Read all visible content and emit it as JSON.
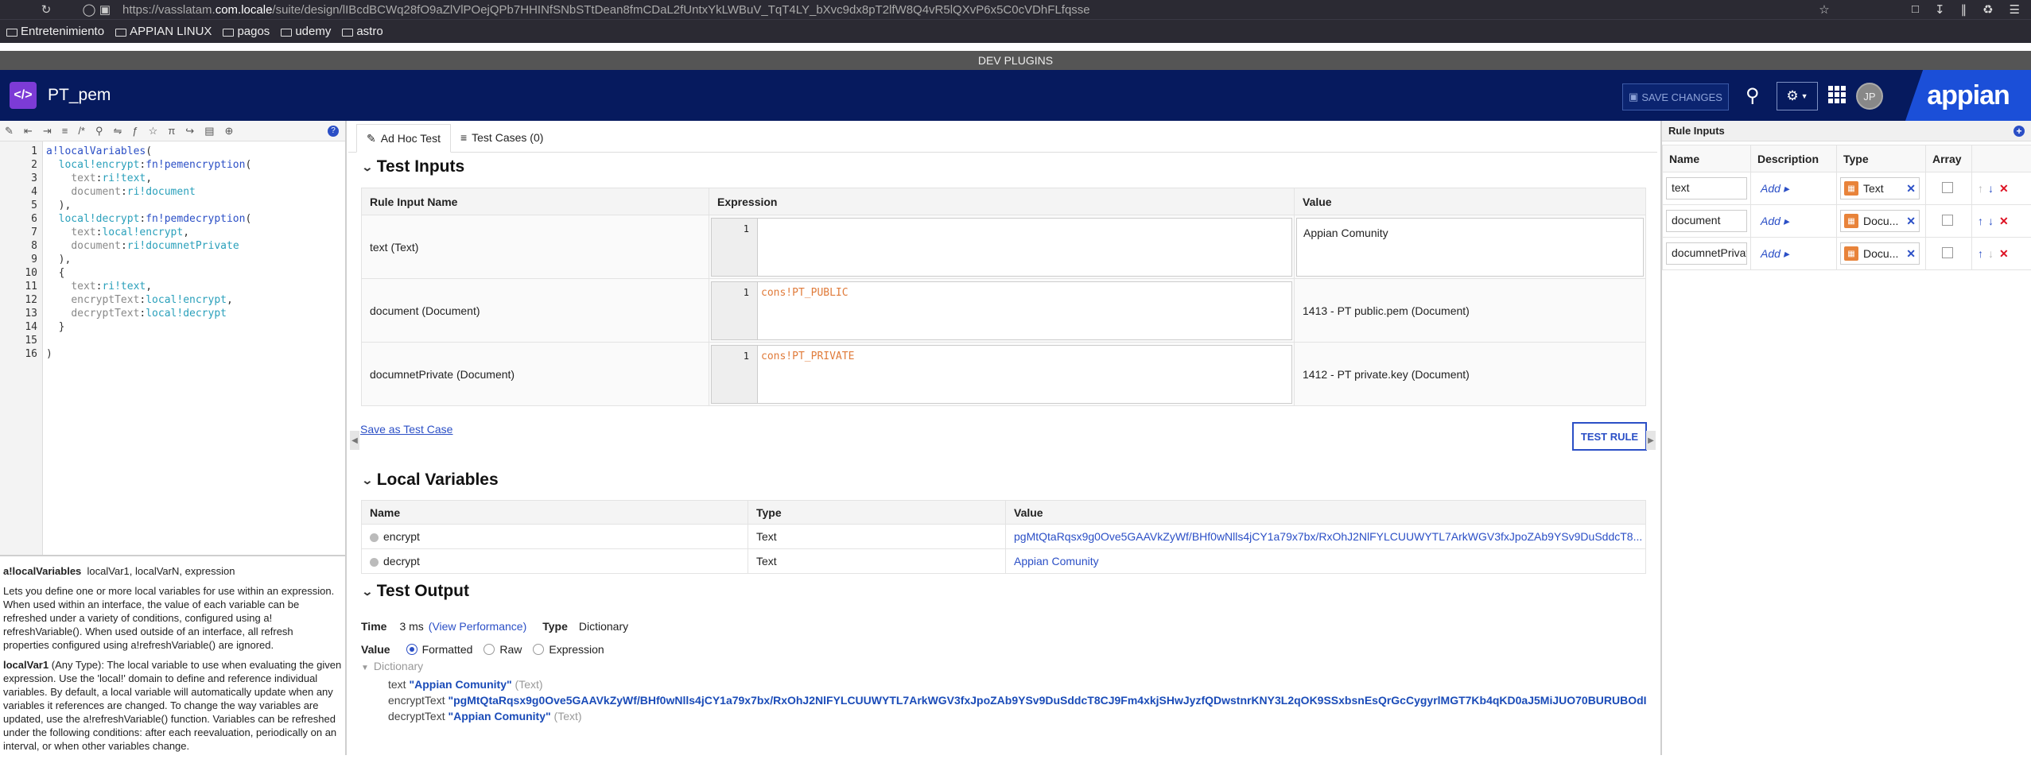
{
  "browser": {
    "url_prefix": "https://vasslatam.",
    "url_domain": "com.locale",
    "url_path": "/suite/design/lIBcdBCWq28fO9aZlVlPOejQPb7HHINfSNbSTtDean8fmCDaL2fUntxYkLWBuV_TqT4LY_bXvc9dx8pT2lfW8Q4vR5lQXvP6x5C0cVDhFLfqsse"
  },
  "bookmarks": [
    "Entretenimiento",
    "APPIAN LINUX",
    "pagos",
    "udemy",
    "astro"
  ],
  "devbar": "DEV PLUGINS",
  "header": {
    "title": "PT_pem",
    "save_label": "SAVE CHANGES",
    "avatar": "JP",
    "logo": "appian"
  },
  "editor": {
    "line_numbers": [
      "1",
      "2",
      "3",
      "4",
      "5",
      "6",
      "7",
      "8",
      "9",
      "10",
      "11",
      "12",
      "13",
      "14",
      "15",
      "16"
    ],
    "docs": {
      "fn_name": "a!localVariables",
      "signature": "localVar1, localVarN, expression",
      "desc": "Lets you define one or more local variables for use within an expression. When used within an interface, the value of each variable can be refreshed under a variety of conditions, configured using a! refreshVariable(). When used outside of an interface, all refresh properties configured using a!refreshVariable() are ignored.",
      "param": "localVar1",
      "param_type": "(Any Type):",
      "param_desc": "The local variable to use when evaluating the given expression. Use the 'local!' domain to define and reference individual variables. By default, a local variable will automatically update when any variables it references are changed. To change the way variables are updated, use the a!refreshVariable() function. Variables can be refreshed under the following conditions: after each reevaluation, periodically on an interval, or when other variables change."
    }
  },
  "tabs": {
    "adhoc": "Ad Hoc Test",
    "cases": "Test Cases (0)"
  },
  "test_inputs": {
    "title": "Test Inputs",
    "headers": [
      "Rule Input Name",
      "Expression",
      "Value"
    ],
    "rows": [
      {
        "name": "text (Text)",
        "line": "1",
        "expr": "",
        "value": "Appian Comunity"
      },
      {
        "name": "document (Document)",
        "line": "1",
        "expr": "cons!PT_PUBLIC",
        "value": "1413 - PT public.pem (Document)"
      },
      {
        "name": "documnetPrivate (Document)",
        "line": "1",
        "expr": "cons!PT_PRIVATE",
        "value": "1412 - PT private.key (Document)"
      }
    ],
    "save_as_case": "Save as Test Case",
    "test_rule": "TEST RULE"
  },
  "local_variables": {
    "title": "Local Variables",
    "headers": [
      "Name",
      "Type",
      "Value"
    ],
    "rows": [
      {
        "name": "encrypt",
        "type": "Text",
        "value": "pgMtQtaRqsx9g0Ove5GAAVkZyWf/BHf0wNlls4jCY1a79x7bx/RxOhJ2NlFYLCUUWYTL7ArkWGV3fxJpoZAb9YSv9DuSddcT8..."
      },
      {
        "name": "decrypt",
        "type": "Text",
        "value": "Appian Comunity"
      }
    ]
  },
  "test_output": {
    "title": "Test Output",
    "time_label": "Time",
    "time_value": "3 ms",
    "view_perf": "(View Performance)",
    "type_label": "Type",
    "type_value": "Dictionary",
    "value_label": "Value",
    "modes": [
      "Formatted",
      "Raw",
      "Expression"
    ],
    "dict_label": "Dictionary",
    "entries": [
      {
        "key": "text",
        "val": "\"Appian Comunity\"",
        "type": "(Text)"
      },
      {
        "key": "encryptText",
        "val": "\"pgMtQtaRqsx9g0Ove5GAAVkZyWf/BHf0wNlls4jCY1a79x7bx/RxOhJ2NlFYLCUUWYTL7ArkWGV3fxJpoZAb9YSv9DuSddcT8CJ9Fm4xkjSHwJyzfQDwstnrKNY3L2qOK9SSxbsnEsQrGcCygyrlMGT7Kb4qKD0aJ5MiJUO70BURUBOdI",
        "type": ""
      },
      {
        "key": "decryptText",
        "val": "\"Appian Comunity\"",
        "type": "(Text)"
      }
    ]
  },
  "rule_inputs": {
    "title": "Rule Inputs",
    "headers": [
      "Name",
      "Description",
      "Type",
      "Array"
    ],
    "add_label": "Add",
    "rows": [
      {
        "name": "text",
        "type": "Text"
      },
      {
        "name": "document",
        "type": "Docu..."
      },
      {
        "name": "documnetPrivate",
        "type": "Docu..."
      }
    ]
  },
  "colors": {
    "header": "#061a5e",
    "accent": "#2b4fc6",
    "logo": "#1b4fd8",
    "code_icon": "#7c3bd6"
  }
}
